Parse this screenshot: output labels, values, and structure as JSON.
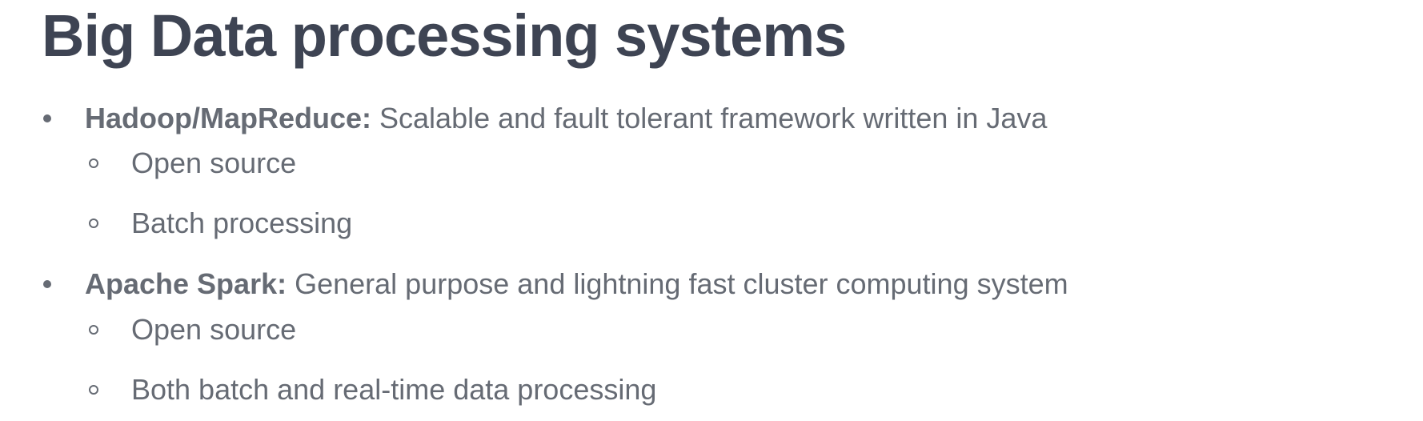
{
  "slide": {
    "title": "Big Data processing systems",
    "items": [
      {
        "lead": "Hadoop/MapReduce:",
        "text": " Scalable and fault tolerant framework written in Java",
        "subitems": [
          "Open source",
          "Batch processing"
        ]
      },
      {
        "lead": "Apache Spark:",
        "text": " General purpose and lightning fast cluster computing system",
        "subitems": [
          "Open source",
          "Both batch and real-time data processing"
        ]
      }
    ]
  }
}
